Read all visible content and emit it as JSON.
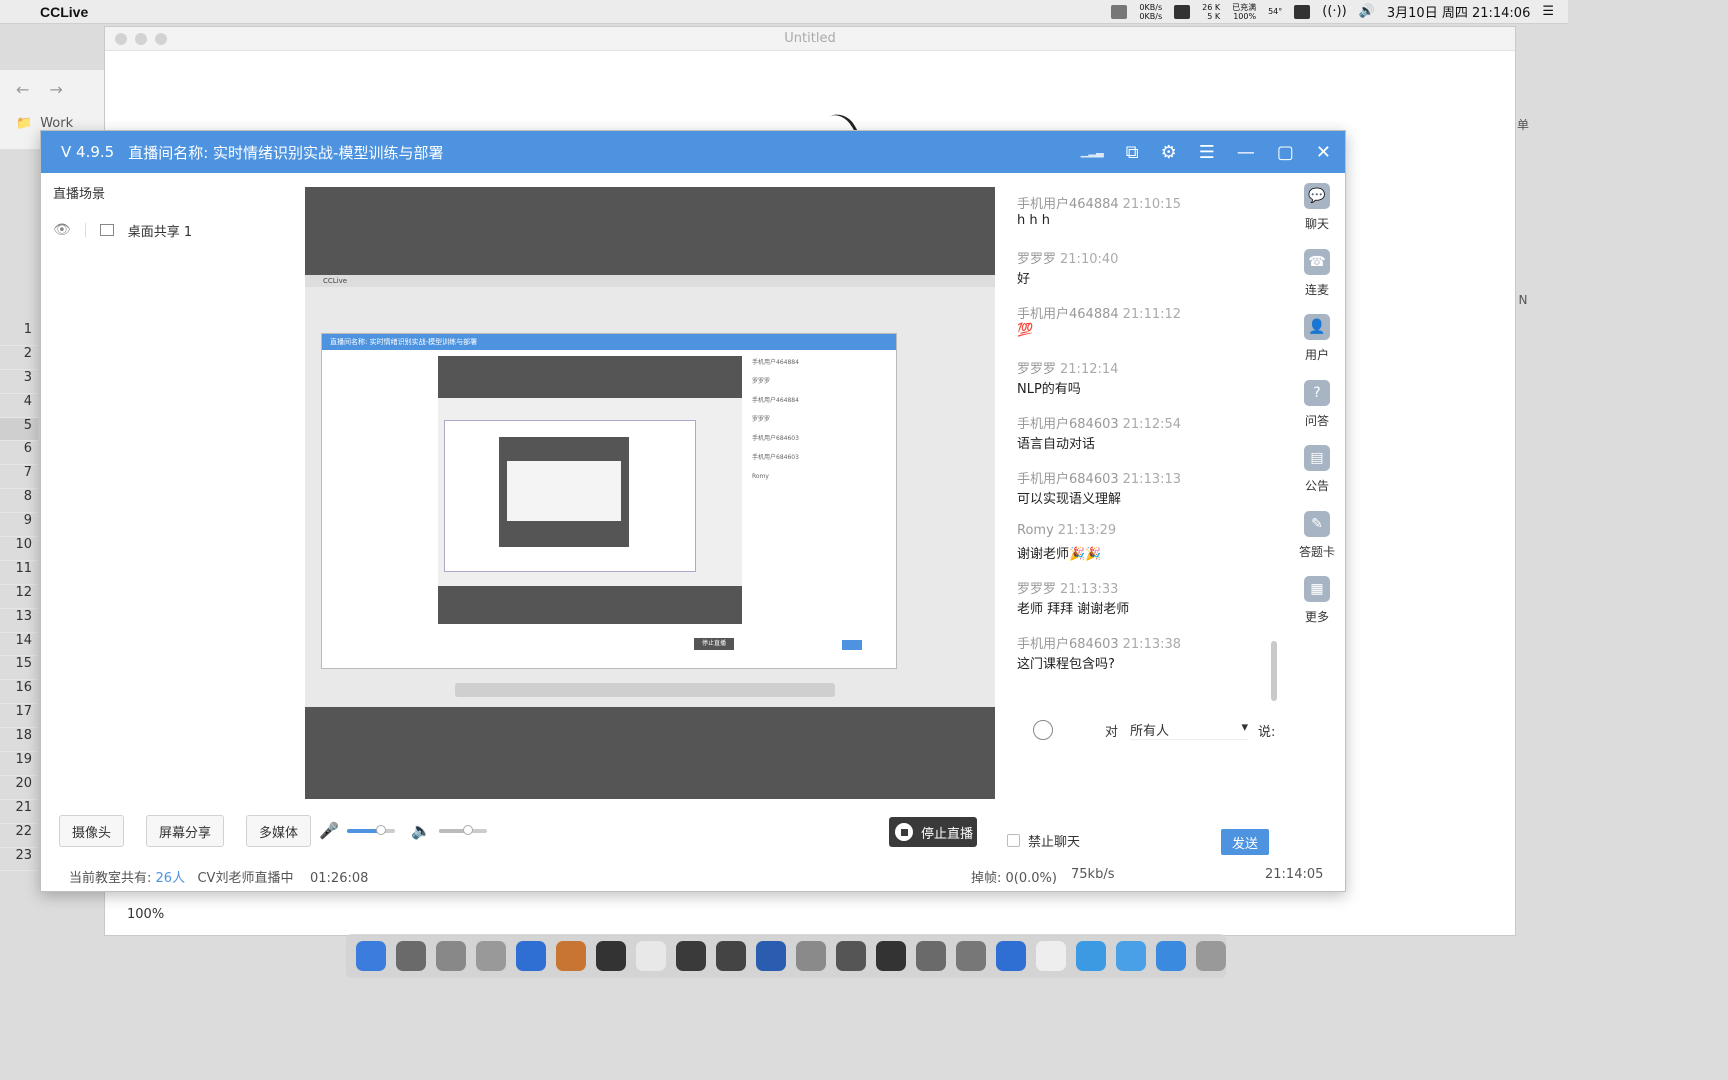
{
  "menubar": {
    "app": "CCLive",
    "net_up": "0KB/s",
    "net_down": "0KB/s",
    "mem_top": "26 K",
    "mem_bottom": "5 K",
    "battery_top": "已充满",
    "battery_bottom": "100%",
    "temp": "54°",
    "datetime": "3月10日 周四  21:14:06"
  },
  "bg_window": {
    "title": "Untitled",
    "zoom": "100%",
    "bookmark": "Work",
    "row_numbers": [
      "1",
      "2",
      "3",
      "4",
      "5",
      "6",
      "7",
      "8",
      "9",
      "10",
      "11",
      "12",
      "13",
      "14",
      "15",
      "16",
      "17",
      "18",
      "19",
      "20",
      "21",
      "22",
      "23"
    ],
    "right_labels": [
      "单",
      "N"
    ]
  },
  "cclive": {
    "version": "V 4.9.5",
    "room_title": "直播间名称: 实时情绪识别实战-模型训练与部署",
    "scene_header": "直播场景",
    "scene_item": "桌面共享 1",
    "chat": [
      {
        "user": "手机用户464884",
        "time": "21:10:15",
        "text": "h h h"
      },
      {
        "user": "罗罗罗",
        "time": "21:10:40",
        "text": "好"
      },
      {
        "user": "手机用户464884",
        "time": "21:11:12",
        "text": "💯"
      },
      {
        "user": "罗罗罗",
        "time": "21:12:14",
        "text": "NLP的有吗"
      },
      {
        "user": "手机用户684603",
        "time": "21:12:54",
        "text": "语言自动对话"
      },
      {
        "user": "手机用户684603",
        "time": "21:13:13",
        "text": "可以实现语义理解"
      },
      {
        "user": "Romy",
        "time": "21:13:29",
        "text": "谢谢老师🎉🎉"
      },
      {
        "user": "罗罗罗",
        "time": "21:13:33",
        "text": "老师 拜拜 谢谢老师"
      },
      {
        "user": "手机用户684603",
        "time": "21:13:38",
        "text": "这门课程包含吗?"
      }
    ],
    "tools": [
      {
        "label": "聊天",
        "icon": "chat-icon"
      },
      {
        "label": "连麦",
        "icon": "phone-icon"
      },
      {
        "label": "用户",
        "icon": "user-icon"
      },
      {
        "label": "问答",
        "icon": "question-icon"
      },
      {
        "label": "公告",
        "icon": "notice-icon"
      },
      {
        "label": "答题卡",
        "icon": "answer-card-icon"
      },
      {
        "label": "更多",
        "icon": "more-icon"
      }
    ],
    "to_label": "对",
    "to_target": "所有人",
    "say_label": "说:",
    "buttons": {
      "camera": "摄像头",
      "screen": "屏幕分享",
      "media": "多媒体"
    },
    "mic_level": 0.7,
    "speaker_level": 0.6,
    "stop_label": "停止直播",
    "ban_chat": "禁止聊天",
    "send": "发送",
    "status": {
      "prefix": "当前教室共有:",
      "count": "26人",
      "host": "CV刘老师直播中",
      "duration": "01:26:08",
      "drop": "掉帧: 0(0.0%)",
      "bitrate": "75kb/s",
      "clock": "21:14:05"
    }
  },
  "colors": {
    "accent": "#4d93e0",
    "preview_bg": "#555555"
  }
}
